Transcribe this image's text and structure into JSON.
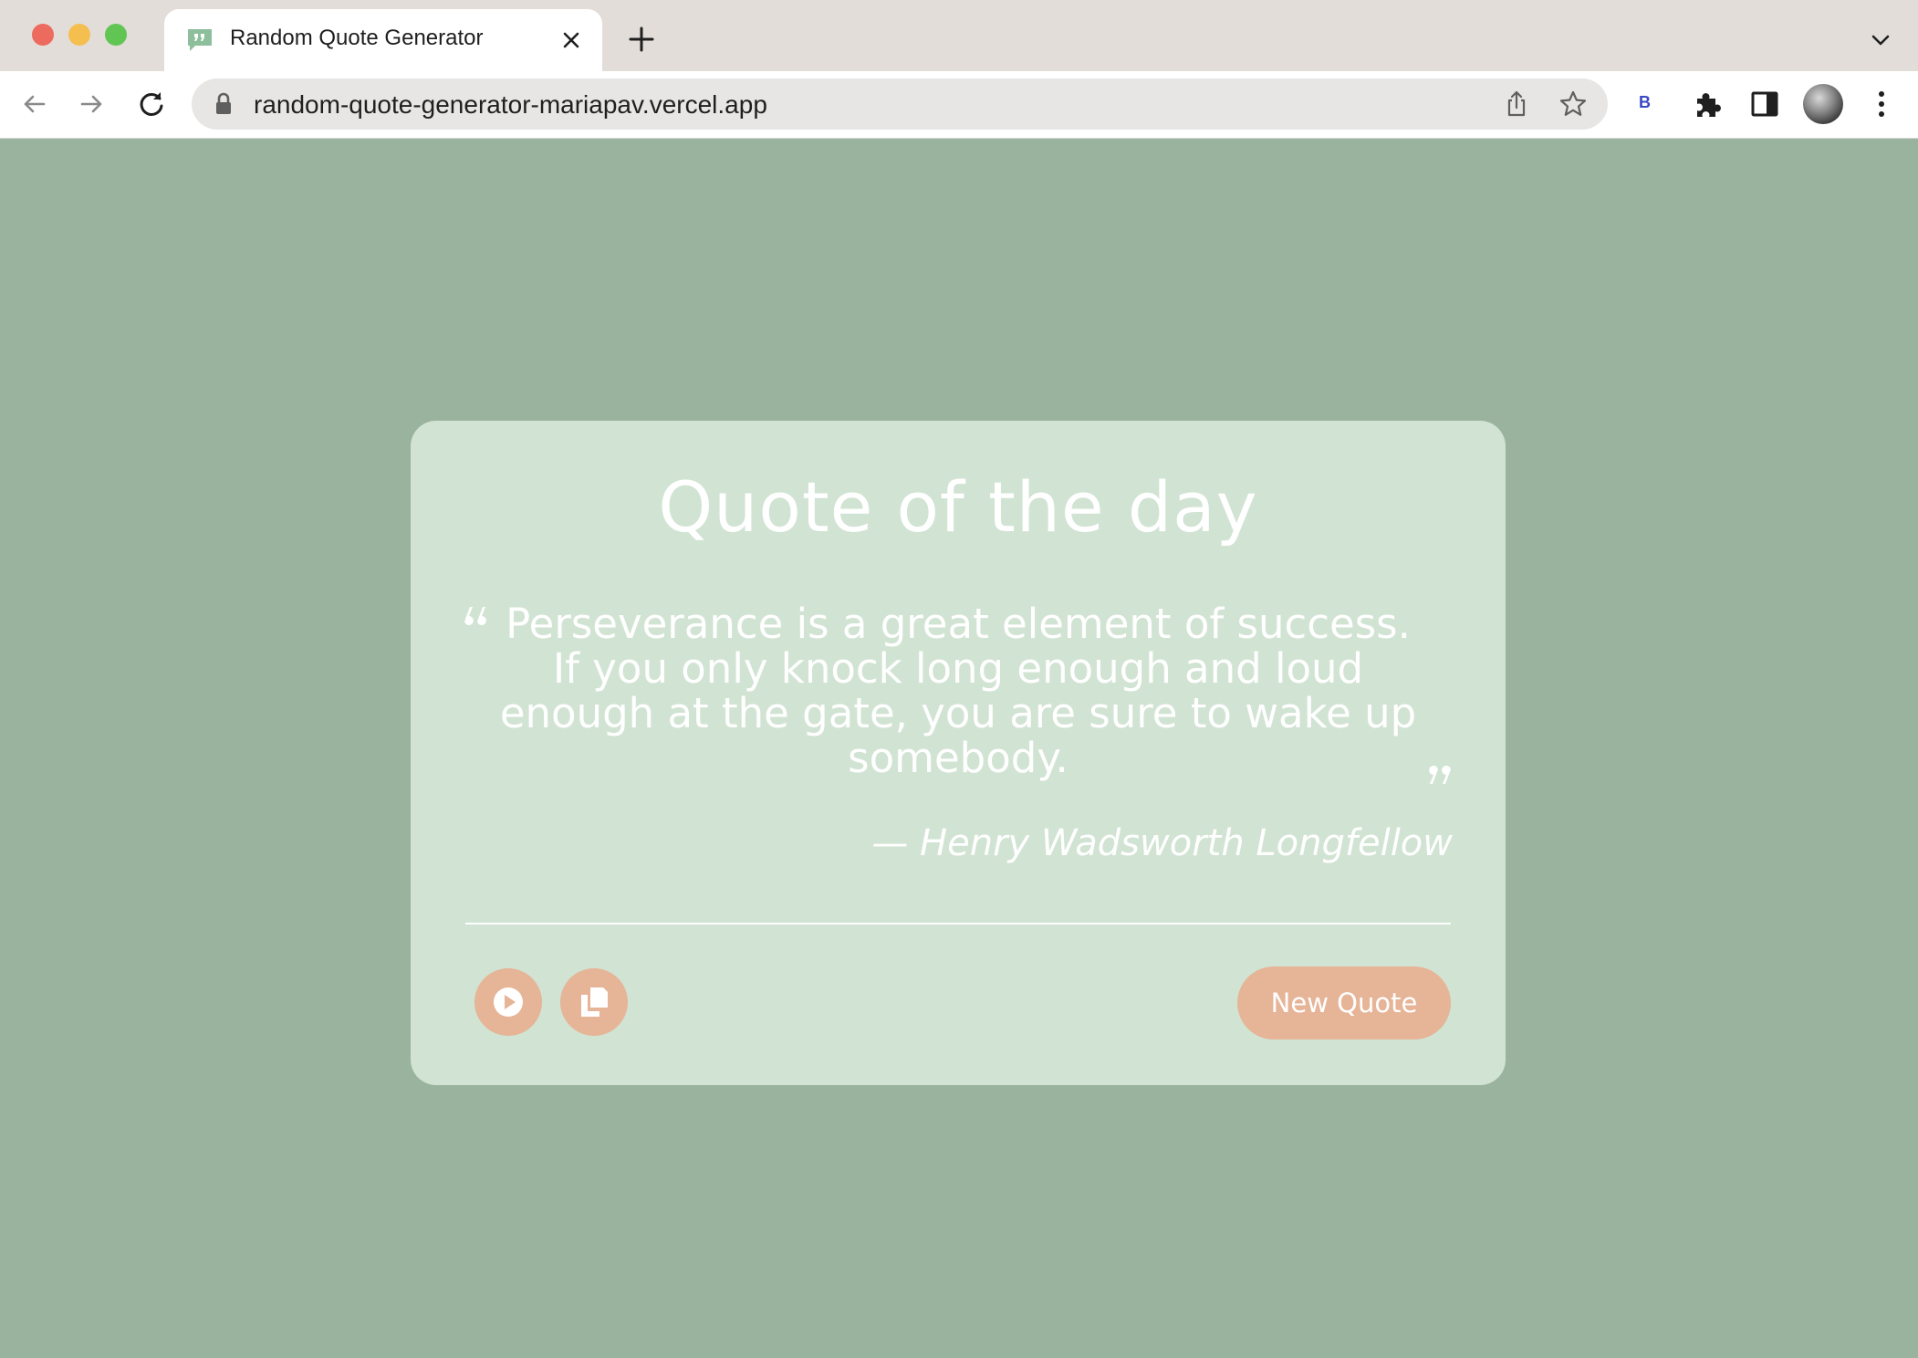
{
  "browser": {
    "tab_title": "Random Quote Generator",
    "url": "random-quote-generator-mariapav.vercel.app",
    "extension_label": "B",
    "icons": {
      "favicon": "quote-bubble-icon",
      "close": "close-icon",
      "new_tab": "plus-icon",
      "tab_list": "chevron-down-icon",
      "back": "arrow-left-icon",
      "forward": "arrow-right-icon",
      "reload": "reload-icon",
      "lock": "lock-icon",
      "share": "share-icon",
      "bookmark": "star-icon",
      "extensions": "puzzle-icon",
      "side_panel": "side-panel-icon",
      "menu": "kebab-menu-icon"
    }
  },
  "card": {
    "title": "Quote of the day",
    "quote": "Perseverance is a great element of success. If you only knock long enough and loud enough at the gate, you are sure to wake up somebody.",
    "author": "— Henry Wadsworth Longfellow",
    "new_quote_label": "New Quote",
    "icons": {
      "open_quote": "open-quote-icon",
      "close_quote": "close-quote-icon",
      "speak": "play-icon",
      "copy": "copy-icon"
    }
  },
  "colors": {
    "page_background": "#9ab39f",
    "card_background": "#d1e3d2",
    "accent_button": "#e6b497",
    "text": "#ffffff"
  }
}
